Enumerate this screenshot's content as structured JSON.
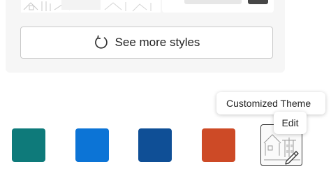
{
  "see_more": {
    "label": "See more styles",
    "icon": "refresh-icon"
  },
  "swatches": [
    {
      "name": "teal",
      "color": "#0e7a7a"
    },
    {
      "name": "blue",
      "color": "#0c74d6"
    },
    {
      "name": "dark-blue",
      "color": "#0f4f96"
    },
    {
      "name": "orange",
      "color": "#cd4a26"
    }
  ],
  "custom_theme": {
    "tooltip": "Customized Theme",
    "edit_tooltip": "Edit",
    "edit_icon": "pencil-icon"
  }
}
